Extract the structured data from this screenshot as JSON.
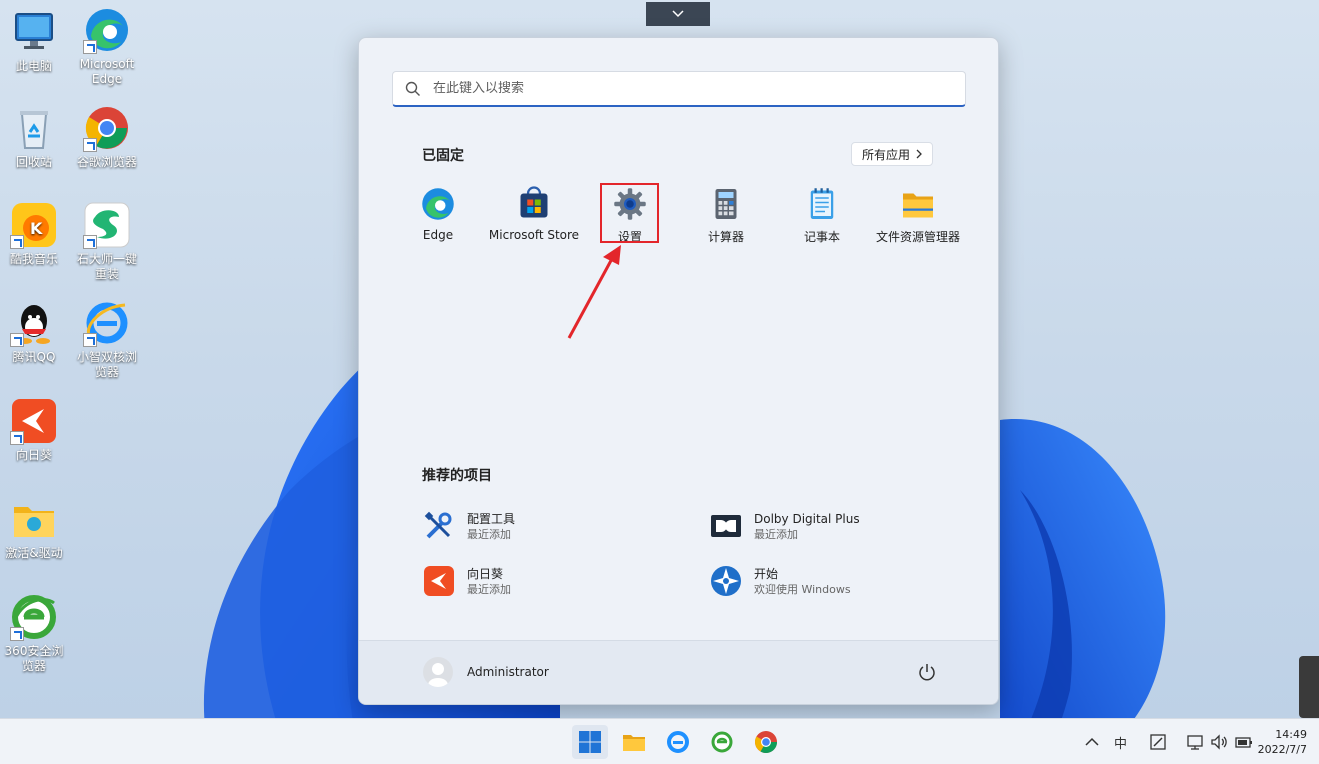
{
  "desktop": {
    "icons": [
      {
        "label": "此电脑",
        "icon": "computer-icon"
      },
      {
        "label": "Microsoft Edge",
        "icon": "edge-icon"
      },
      {
        "label": "回收站",
        "icon": "recycle-bin-icon"
      },
      {
        "label": "谷歌浏览器",
        "icon": "chrome-icon"
      },
      {
        "label": "酷我音乐",
        "icon": "kuwo-music-icon"
      },
      {
        "label": "石大师一键重装",
        "icon": "reinstall-tool-icon"
      },
      {
        "label": "腾讯QQ",
        "icon": "qq-icon"
      },
      {
        "label": "小智双核浏览器",
        "icon": "ie-browser-icon"
      },
      {
        "label": "向日葵",
        "icon": "sunflower-icon"
      },
      {
        "label": "激活&驱动",
        "icon": "folder-icon"
      },
      {
        "label": "360安全浏览器",
        "icon": "360-browser-icon"
      }
    ]
  },
  "start_menu": {
    "search": {
      "placeholder": "在此键入以搜索"
    },
    "pinned_title": "已固定",
    "all_apps_label": "所有应用",
    "pinned": [
      {
        "label": "Edge",
        "icon": "edge-icon"
      },
      {
        "label": "Microsoft Store",
        "icon": "store-icon"
      },
      {
        "label": "设置",
        "icon": "gear-icon"
      },
      {
        "label": "计算器",
        "icon": "calculator-icon"
      },
      {
        "label": "记事本",
        "icon": "notepad-icon"
      },
      {
        "label": "文件资源管理器",
        "icon": "file-explorer-icon"
      }
    ],
    "recommended_title": "推荐的项目",
    "recommended": [
      {
        "title": "配置工具",
        "subtitle": "最近添加",
        "icon": "tools-icon"
      },
      {
        "title": "Dolby Digital Plus",
        "subtitle": "最近添加",
        "icon": "dolby-icon"
      },
      {
        "title": "向日葵",
        "subtitle": "最近添加",
        "icon": "sunflower-icon"
      },
      {
        "title": "开始",
        "subtitle": "欢迎使用 Windows",
        "icon": "get-started-icon"
      }
    ],
    "user_name": "Administrator"
  },
  "taskbar": {
    "tray_input": "中",
    "clock_time": "14:49",
    "clock_date": "2022/7/7"
  },
  "colors": {
    "accent": "#2c63c3",
    "highlight_box": "#e3262b",
    "arrow": "#e3262b"
  }
}
